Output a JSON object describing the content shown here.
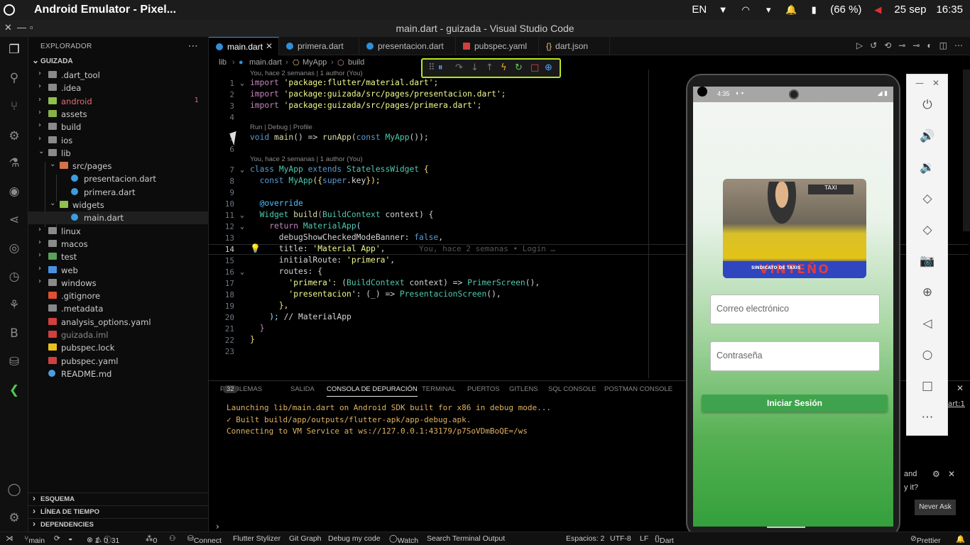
{
  "topbar": {
    "title": "Android Emulator - Pixel...",
    "lang": "EN",
    "battery": "(66 %)",
    "date": "25 sep",
    "time": "16:35"
  },
  "window": {
    "title": "main.dart - guizada - Visual Studio Code"
  },
  "sidebar": {
    "header": "EXPLORADOR",
    "project": "GUIZADA",
    "items": [
      {
        "name": ".dart_tool",
        "kind": "folder"
      },
      {
        "name": ".idea",
        "kind": "folder"
      },
      {
        "name": "android",
        "kind": "folder",
        "badge": "1"
      },
      {
        "name": "assets",
        "kind": "folder"
      },
      {
        "name": "build",
        "kind": "folder"
      },
      {
        "name": "ios",
        "kind": "folder"
      },
      {
        "name": "lib",
        "kind": "folder"
      },
      {
        "name": "src/pages",
        "kind": "folder"
      },
      {
        "name": "presentacion.dart",
        "kind": "dart"
      },
      {
        "name": "primera.dart",
        "kind": "dart"
      },
      {
        "name": "widgets",
        "kind": "folder"
      },
      {
        "name": "main.dart",
        "kind": "dart"
      },
      {
        "name": "linux",
        "kind": "folder"
      },
      {
        "name": "macos",
        "kind": "folder"
      },
      {
        "name": "test",
        "kind": "folder"
      },
      {
        "name": "web",
        "kind": "folder"
      },
      {
        "name": "windows",
        "kind": "folder"
      },
      {
        "name": ".gitignore",
        "kind": "git"
      },
      {
        "name": ".metadata",
        "kind": "file"
      },
      {
        "name": "analysis_options.yaml",
        "kind": "yaml"
      },
      {
        "name": "guizada.iml",
        "kind": "iml"
      },
      {
        "name": "pubspec.lock",
        "kind": "lock"
      },
      {
        "name": "pubspec.yaml",
        "kind": "yaml"
      },
      {
        "name": "README.md",
        "kind": "info"
      }
    ],
    "sections": [
      "ESQUEMA",
      "LÍNEA DE TIEMPO",
      "DEPENDENCIES"
    ]
  },
  "tabs": [
    "main.dart",
    "primera.dart",
    "presentacion.dart",
    "pubspec.yaml",
    "dart.json"
  ],
  "breadcrumb": [
    "lib",
    "main.dart",
    "MyApp",
    "build"
  ],
  "editor": {
    "lens_top": "You, hace 2 semanas | 1 author (You)",
    "lens_run": "Run | Debug | Profile",
    "lens_class": "You, hace 2 semanas | 1 author (You)",
    "blame": "You, hace 2 semanas • Login …",
    "line_numbers": [
      "1",
      "2",
      "3",
      "4",
      "5",
      "6",
      "7",
      "8",
      "9",
      "10",
      "11",
      "12",
      "13",
      "14",
      "15",
      "16",
      "17",
      "18",
      "19",
      "20",
      "21",
      "22",
      "23"
    ],
    "lines": {
      "l1a": "import ",
      "l1b": "'package:flutter/material.dart'",
      "l1c": ";",
      "l2a": "import ",
      "l2b": "'package:guizada/src/pages/presentacion.dart'",
      "l2c": ";",
      "l3a": "import ",
      "l3b": "'package:guizada/src/pages/primera.dart'",
      "l3c": ";",
      "l5a": "void ",
      "l5b": "main",
      "l5c": "() => ",
      "l5d": "runApp",
      "l5e": "(",
      "l5f": "const ",
      "l5g": "MyApp",
      "l5h": "());",
      "l7a": "class ",
      "l7b": "MyApp ",
      "l7c": "extends ",
      "l7d": "StatelessWidget",
      "l7e": " {",
      "l8a": "  const ",
      "l8b": "MyApp",
      "l8c": "({",
      "l8d": "super",
      "l8e": ".key",
      "l8f": "});",
      "l10": "  @override",
      "l11a": "  Widget ",
      "l11b": "build",
      "l11c": "(",
      "l11d": "BuildContext",
      "l11e": " context) {",
      "l12a": "    return ",
      "l12b": "MaterialApp",
      "l12c": "(",
      "l13a": "      debugShowCheckedModeBanner: ",
      "l13b": "false",
      "l13c": ",",
      "l14a": "      title: ",
      "l14b": "'Material App'",
      "l14c": ",",
      "l15a": "      initialRoute: ",
      "l15b": "'primera'",
      "l15c": ",",
      "l16a": "      routes: {",
      "l17a": "        ",
      "l17b": "'primera'",
      "l17c": ": (",
      "l17d": "BuildContext",
      "l17e": " context) => ",
      "l17f": "PrimerScreen",
      "l17g": "(),",
      "l18a": "        ",
      "l18b": "'presentacion'",
      "l18c": ": (_) => ",
      "l18d": "PresentacionScreen",
      "l18e": "(),",
      "l19": "      },",
      "l20a": "    ); ",
      "l20b": "// MaterialApp",
      "l21": "  }",
      "l22": "}"
    }
  },
  "panel": {
    "tabs": [
      "PROBLEMAS",
      "SALIDA",
      "CONSOLA DE DEPURACIÓN",
      "TERMINAL",
      "PUERTOS",
      "GITLENS",
      "SQL CONSOLE",
      "POSTMAN CONSOLE"
    ],
    "problems_count": "32",
    "output": [
      "Launching lib/main.dart on Android SDK built for x86 in debug mode...",
      "✓  Built build/app/outputs/flutter-apk/app-debug.apk.",
      "Connecting to VM Service at ws://127.0.0.1:43179/p7SoVDmBoQE=/ws"
    ]
  },
  "emulator": {
    "status_time": "4:35",
    "email_placeholder": "Correo electrónico",
    "password_placeholder": "Contraseña",
    "login_button": "Iniciar Sesión",
    "logo_text": "VINTEÑO",
    "logo_subtext": "SINDICATO DE TAXIS",
    "logo_taxi": "TAXI"
  },
  "notification": {
    "line1": "and",
    "line2": "y it?",
    "never_ask": "Never Ask",
    "side_text": "art:1"
  },
  "statusbar": {
    "branch": "main",
    "errors": "1",
    "warnings": "0",
    "infos": "31",
    "ports": "0",
    "connect": "Connect",
    "stylizer": "Flutter Stylizer",
    "gitgraph": "Git Graph",
    "debugcode": "Debug my code",
    "watch": "Watch",
    "searchterm": "Search Terminal Output",
    "spaces": "Espacios: 2",
    "encoding": "UTF-8",
    "eol": "LF",
    "lang": "Dart",
    "prettier": "Prettier"
  },
  "colors": {
    "accent": "#3b8eea",
    "highlight": "#b5e61d",
    "appgreen": "#3fa34d"
  }
}
